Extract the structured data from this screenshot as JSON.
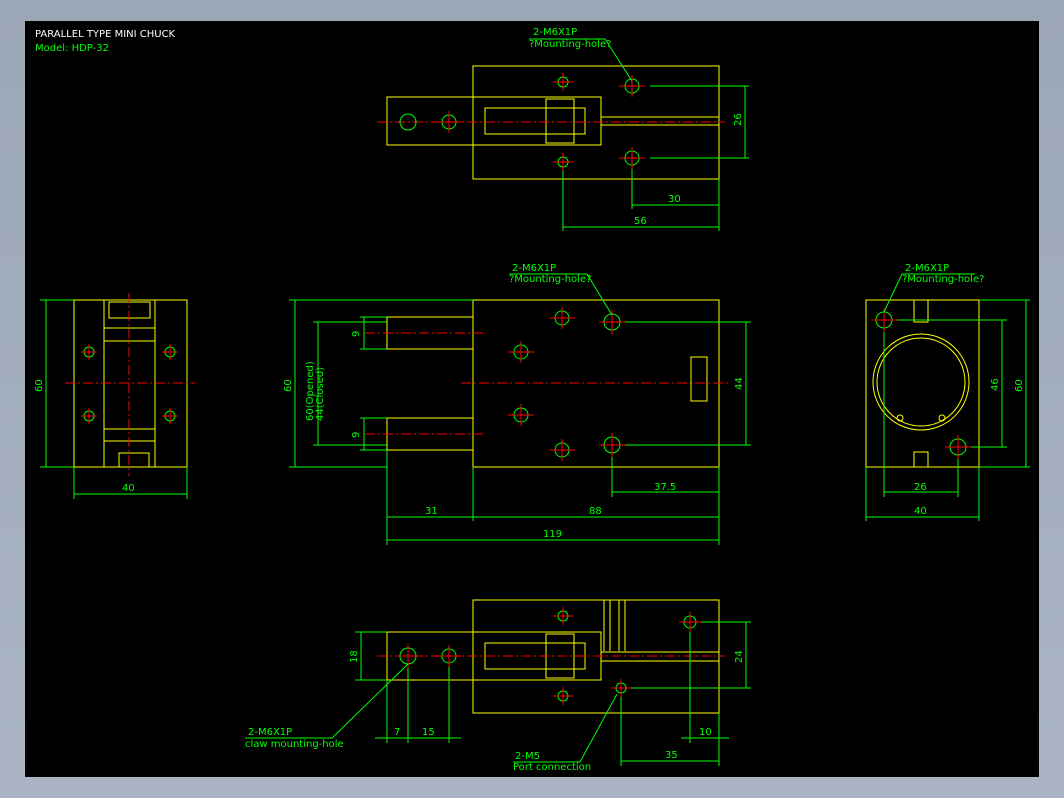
{
  "title": "PARALLEL TYPE MINI CHUCK",
  "model": "Model:  HDP-32",
  "views": {
    "top": {
      "hole_label": "2-M6X1P",
      "hole_note": "?Mounting-hole?",
      "dim_height": "26",
      "dim_30": "30",
      "dim_56": "56"
    },
    "left": {
      "dim_height": "60",
      "dim_width": "40"
    },
    "front": {
      "hole_label": "2-M6X1P",
      "hole_note": "?Mounting-hole?",
      "dim_height": "60",
      "dim_opened": "60(Opened)",
      "dim_closed": "44(Closed)",
      "dim_9_top": "9",
      "dim_9_bottom": "9",
      "dim_44": "44",
      "dim_37_5": "37.5",
      "dim_31": "31",
      "dim_88": "88",
      "dim_119": "119"
    },
    "right": {
      "hole_label": "2-M6X1P",
      "hole_note": "?Mounting-hole?",
      "dim_46": "46",
      "dim_60": "60",
      "dim_26": "26",
      "dim_40": "40"
    },
    "bottom": {
      "dim_18": "18",
      "dim_24": "24",
      "dim_7": "7",
      "dim_15": "15",
      "dim_10": "10",
      "dim_35": "35",
      "claw_label": "2-M6X1P",
      "claw_note": "claw mounting-hole",
      "port_label": "2-M5",
      "port_note": "Port connection"
    }
  }
}
